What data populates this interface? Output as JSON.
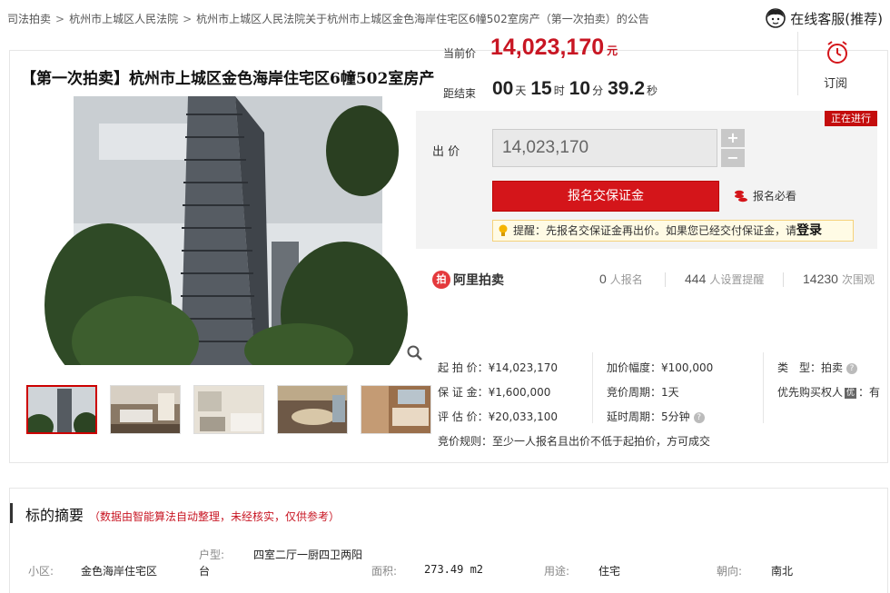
{
  "breadcrumb": {
    "items": [
      "司法拍卖",
      "杭州市上城区人民法院",
      "杭州市上城区人民法院关于杭州市上城区金色海岸住宅区6幢502室房产（第一次拍卖）的公告"
    ],
    "separator": ">"
  },
  "service": {
    "label": "在线客服(推荐)"
  },
  "item": {
    "title": "【第一次拍卖】杭州市上城区金色海岸住宅区6幢502室房产"
  },
  "price": {
    "current_label": "当前价",
    "current_value": "14,023,170",
    "currency": "元",
    "countdown_label": "距结束",
    "countdown": {
      "days": "00",
      "days_unit": "天",
      "hours": "15",
      "hours_unit": "时",
      "minutes": "10",
      "minutes_unit": "分",
      "seconds": "39.2",
      "seconds_unit": "秒"
    }
  },
  "subscribe": {
    "label": "订阅"
  },
  "status_badge": "正在进行",
  "bid": {
    "label": "出 价",
    "input_value": "14,023,170",
    "plus": "+",
    "minus": "−",
    "deposit_button": "报名交保证金",
    "must_read": "报名必看",
    "tip_text": "提醒：先报名交保证金再出价。如果您已经交付保证金，请",
    "tip_login": "登录"
  },
  "stats": {
    "brand": "阿里拍卖",
    "signups_value": "0",
    "signups_label": "人报名",
    "reminders_value": "444",
    "reminders_label": "人设置提醒",
    "views_value": "14230",
    "views_label": "次围观"
  },
  "details": {
    "start_price_label": "起 拍 价：",
    "start_price": "¥14,023,170",
    "deposit_label": "保 证 金：",
    "deposit": "¥1,600,000",
    "appraisal_label": "评 估 价：",
    "appraisal": "¥20,033,100",
    "increment_label": "加价幅度：",
    "increment": "¥100,000",
    "cycle_label": "竞价周期：",
    "cycle": "1天",
    "delay_label": "延时周期：",
    "delay": "5分钟",
    "type_label": "类　型：",
    "type": "拍卖",
    "priority_label": "优先购买权人",
    "priority_tag": "优",
    "priority_value": "：有",
    "rule_label": "竞价规则：",
    "rule": "至少一人报名且出价不低于起拍价，方可成交"
  },
  "summary": {
    "title": "标的摘要",
    "note": "（数据由智能算法自动整理，未经核实，仅供参考）",
    "community_label": "小区:",
    "community": "金色海岸住宅区",
    "layout_label": "户型:",
    "layout_value": "四室二厅一厨四卫两阳",
    "layout_suffix": "台",
    "area_label": "面积:",
    "area": "273.49 m2",
    "usage_label": "用途:",
    "usage": "住宅",
    "orientation_label": "朝向:",
    "orientation": "南北"
  },
  "colors": {
    "accent_red": "#c81623",
    "button_red": "#d4151a",
    "badge_red": "#c40d0d"
  }
}
